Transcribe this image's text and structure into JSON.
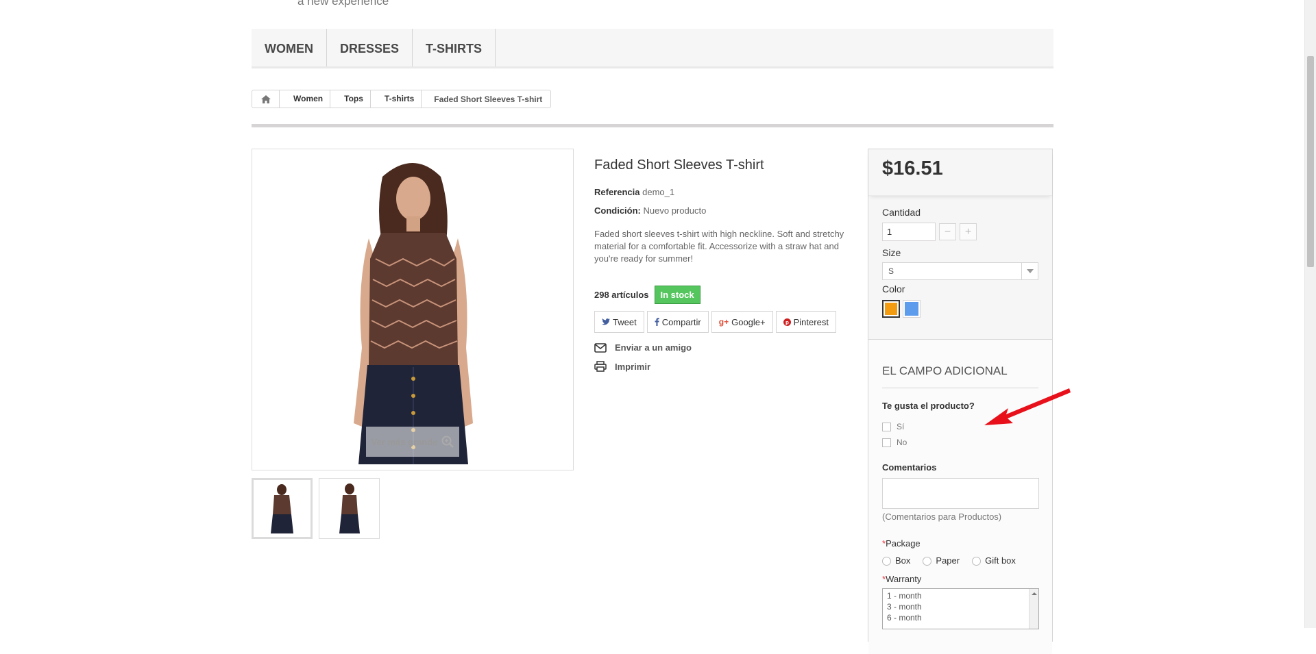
{
  "top_tagline": "a new experience",
  "nav": {
    "items": [
      "WOMEN",
      "DRESSES",
      "T-SHIRTS"
    ]
  },
  "breadcrumb": {
    "items": [
      "Women",
      "Tops",
      "T-shirts"
    ],
    "current": "Faded Short Sleeves T-shirt"
  },
  "gallery": {
    "zoom_label": "Ver más grande"
  },
  "product": {
    "title": "Faded Short Sleeves T-shirt",
    "reference_label": "Referencia",
    "reference_value": "demo_1",
    "condition_label": "Condición:",
    "condition_value": "Nuevo producto",
    "description": "Faded short sleeves t-shirt with high neckline. Soft and stretchy material for a comfortable fit. Accessorize with a straw hat and you're ready for summer!",
    "stock_count": "298 artículos",
    "stock_badge": "In stock"
  },
  "share": {
    "tweet": "Tweet",
    "facebook": "Compartir",
    "google": "Google+",
    "pinterest": "Pinterest"
  },
  "actions": {
    "send_friend": "Enviar a un amigo",
    "print": "Imprimir"
  },
  "buybox": {
    "price": "$16.51",
    "quantity_label": "Cantidad",
    "quantity_value": "1",
    "size_label": "Size",
    "size_value": "S",
    "color_label": "Color",
    "colors": [
      "#f39c11",
      "#5d9cec"
    ]
  },
  "extra_fields": {
    "title": "EL CAMPO ADICIONAL",
    "question": "Te gusta el producto?",
    "options": [
      "Sí",
      "No"
    ],
    "comments_label": "Comentarios",
    "comments_hint": "(Comentarios para Productos)",
    "package_label": "Package",
    "package_options": [
      "Box",
      "Paper",
      "Gift box"
    ],
    "warranty_label": "Warranty",
    "warranty_options": [
      "1 - month",
      "3 - month",
      "6 - month"
    ]
  },
  "colors": {
    "badge_green": "#55c65e",
    "annotation_red": "#e8101a",
    "required_red": "#f13340"
  }
}
